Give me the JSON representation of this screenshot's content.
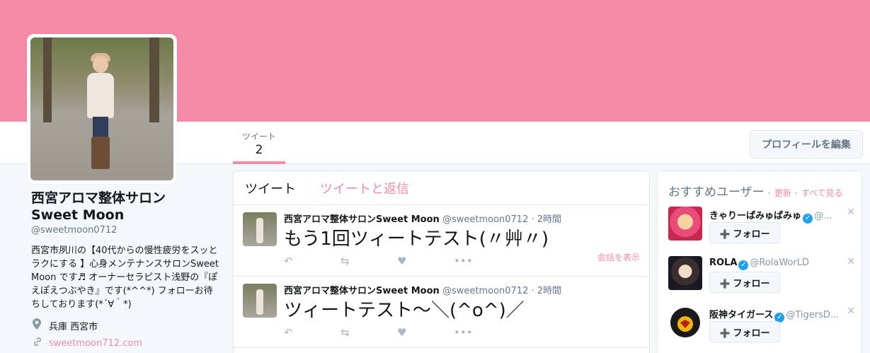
{
  "stats": {
    "tweets_label": "ツイート",
    "tweets_count": "2"
  },
  "edit_profile_label": "プロフィールを編集",
  "profile": {
    "name_line1": "西宮アロマ整体サロン",
    "name_line2": "Sweet Moon",
    "handle": "@sweetmoon0712",
    "bio": "西宮市夙川の【40代からの慢性疲労をスッとラクにする 】心身メンテナンスサロンSweet Moon です♬ オーナーセラピスト浅野の『ぽえぽえつぶやき』です(*^^*) フォローお待ちしております(*´∀｀*)",
    "location": "兵庫 西宮市",
    "url": "sweetmoon712.com"
  },
  "timeline": {
    "tab_tweets": "ツイート",
    "tab_replies": "ツイートと返信",
    "tweets": [
      {
        "name": "西宮アロマ整体サロンSweet Moon",
        "handle": "@sweetmoon0712",
        "time": "· 2時間",
        "text": "もう1回ツィートテスト(〃艸〃)",
        "convo": "会話を表示"
      },
      {
        "name": "西宮アロマ整体サロンSweet Moon",
        "handle": "@sweetmoon0712",
        "time": "· 2時間",
        "text": "ツィートテスト〜＼(^o^)／",
        "convo": ""
      }
    ]
  },
  "suggestions": {
    "title": "おすすめユーザー",
    "refresh": "更新",
    "view_all": "すべて見る",
    "follow_label": "フォロー",
    "users": [
      {
        "name": "きゃりーぱみゅぱみゅ",
        "handle": "@..."
      },
      {
        "name": "ROLA",
        "handle": "@RolaWorLD"
      },
      {
        "name": "阪神タイガース",
        "handle": "@TigersD..."
      }
    ]
  },
  "colors": {
    "accent": "#f48aa6",
    "banner": "#f48aa6",
    "verified": "#1da1f2"
  }
}
